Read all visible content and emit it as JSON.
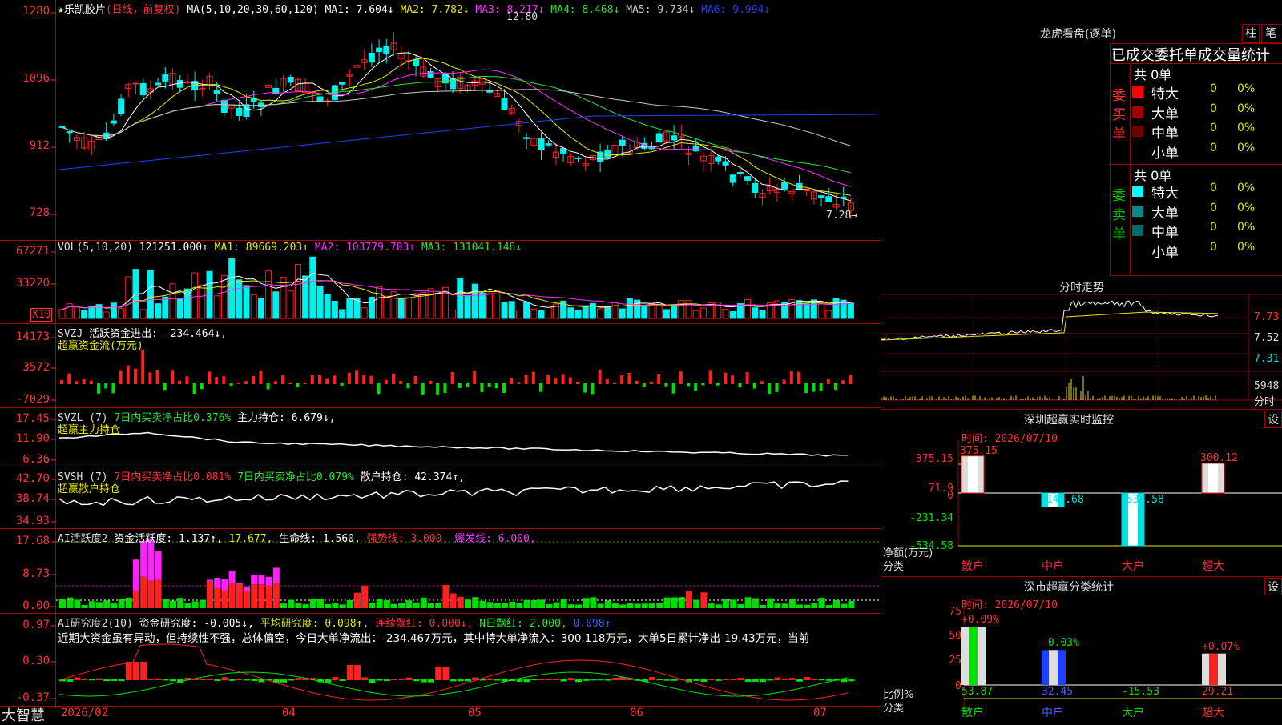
{
  "colors": {
    "up": "#ff2020",
    "down": "#00f0f0",
    "ma1": "#ffffff",
    "ma2": "#e8e800",
    "ma3": "#ff30ff",
    "ma4": "#30e030",
    "ma5": "#c8c8c8",
    "ma6": "#2040ff",
    "grid": "#a00000",
    "green": "#00e000"
  },
  "price_header": {
    "star": "★",
    "name": "乐凯胶片",
    "period": "(日线，前复权)",
    "ma_label": "MA(5,10,20,30,60,120)",
    "ma1": "MA1: 7.604↓",
    "ma2": "MA2: 7.782↓",
    "ma3": "MA3: 8.217↓",
    "ma4": "MA4: 8.468↓",
    "ma5": "MA5: 9.734↓",
    "ma6": "MA6: 9.994↓"
  },
  "price_axis": [
    "1280",
    "1096",
    "912",
    "728"
  ],
  "price_marks": {
    "high": "12.80",
    "low": "7.28→"
  },
  "vol_header": {
    "label": "VOL(5,10,20)",
    "val": "121251.000↑",
    "ma1": "MA1: 89669.203↑",
    "ma2": "MA2: 103779.703↑",
    "ma3": "MA3: 131041.148↓"
  },
  "vol_axis": [
    "67271",
    "33220"
  ],
  "vol_unit": "X10",
  "svzj": {
    "label": "SVZJ",
    "t1": "活跃资金进出: -234.464↓,",
    "t2": "超赢资金流(万元)",
    "axis": [
      "14173",
      "3572",
      "-7029"
    ]
  },
  "svzl": {
    "label": "SVZL (7)",
    "t1": "7日内买卖净占比0.376%",
    "t2": "主力持仓: 6.679↓,",
    "t3": "超赢主力持仓",
    "axis": [
      "17.45",
      "11.90",
      "6.36"
    ]
  },
  "svsh": {
    "label": "SVSH (7)",
    "t1": "7日内买卖净占比0.081%",
    "t2": "7日内买卖净占比0.079%",
    "t3": "散户持仓: 42.374↑,",
    "t4": "超赢散户持仓",
    "axis": [
      "42.70",
      "38.74",
      "34.93"
    ]
  },
  "ai1": {
    "label": "AI活跃度2",
    "t1": "资金活跃度: 1.137↑,",
    "t2": "17.677,",
    "t3": "生命线: 1.560,",
    "t4": "强势线: 3.000,",
    "t5": "爆发线: 6.000,",
    "axis": [
      "17.68",
      "8.73",
      "0.00"
    ]
  },
  "ai2": {
    "label": "AI研究度2(10)",
    "t1": "资金研究度: -0.005↓,",
    "t2": "平均研究度: 0.098↑,",
    "t3": "连续飘红: 0.000↓,",
    "t4": "N日飘红: 2.000,",
    "t5": "0.098↑",
    "axis": [
      "0.97",
      "0.30",
      "-0.37"
    ],
    "desc": "近期大资金虽有异动，但持续性不强，总体偏空，今日大单净流出：-234.467万元，其中特大单净流入：300.118万元，大单5日累计净出-19.43万元，当前"
  },
  "bottom": {
    "brand": "大智慧",
    "dates": [
      "2026/02",
      "04",
      "05",
      "06",
      "07"
    ]
  },
  "dragon": {
    "title": "龙虎看盘(逐单)",
    "btn1": "柱",
    "btn2": "笔",
    "tabs": "已成交委托单成交量统计",
    "buy": {
      "side": "委买单",
      "total": "共 0单",
      "rows": [
        {
          "name": "特大",
          "val": "0",
          "pct": "0%",
          "color": "#ff0000"
        },
        {
          "name": "大单",
          "val": "0",
          "pct": "0%",
          "color": "#a00000"
        },
        {
          "name": "中单",
          "val": "0",
          "pct": "0%",
          "color": "#700000"
        },
        {
          "name": "小单",
          "val": "0",
          "pct": "0%",
          "color": ""
        }
      ]
    },
    "sell": {
      "side": "委卖单",
      "total": "共 0单",
      "rows": [
        {
          "name": "特大",
          "val": "0",
          "pct": "0%",
          "color": "#00ffff"
        },
        {
          "name": "大单",
          "val": "0",
          "pct": "0%",
          "color": "#008a8a"
        },
        {
          "name": "中单",
          "val": "0",
          "pct": "0%",
          "color": "#006a6a"
        },
        {
          "name": "小单",
          "val": "0",
          "pct": "0%",
          "color": ""
        }
      ]
    }
  },
  "intraday": {
    "title": "分时走势",
    "axis": [
      "7.73",
      "7.52",
      "7.31"
    ],
    "vol": "5948",
    "vol_label": "分时"
  },
  "monitor": {
    "title": "深圳超赢实时监控",
    "btn": "设",
    "time": "时间: 2026/07/10",
    "axis": [
      "375.15",
      "71.9",
      "0",
      "-231.34",
      "-534.58"
    ],
    "bars": [
      {
        "cat": "散户",
        "val": 375.15,
        "label": "375.15"
      },
      {
        "cat": "中户",
        "val": -140.68,
        "label": "-140.68"
      },
      {
        "cat": "大户",
        "val": -534.58,
        "label": "-534.58"
      },
      {
        "cat": "超大",
        "val": 300.12,
        "label": "300.12"
      }
    ],
    "ylabel": "净额(万元)",
    "xlabel": "分类"
  },
  "classify": {
    "title": "深市超赢分类统计",
    "btn": "设",
    "time": "时间: 2026/07/10",
    "axis": [
      "75",
      "50",
      "25",
      "0"
    ],
    "bars": [
      {
        "cat": "散户",
        "top": "+0.09%",
        "bottom": "53.87",
        "val": 53.87
      },
      {
        "cat": "中户",
        "top": "-0.03%",
        "bottom": "32.45",
        "val": 32.45
      },
      {
        "cat": "大户",
        "top": "",
        "bottom": "-15.53",
        "val": -15.53
      },
      {
        "cat": "超大",
        "top": "+0.07%",
        "bottom": "29.21",
        "val": 29.21
      }
    ],
    "ylabel": "比例%",
    "xlabel": "分类"
  }
}
